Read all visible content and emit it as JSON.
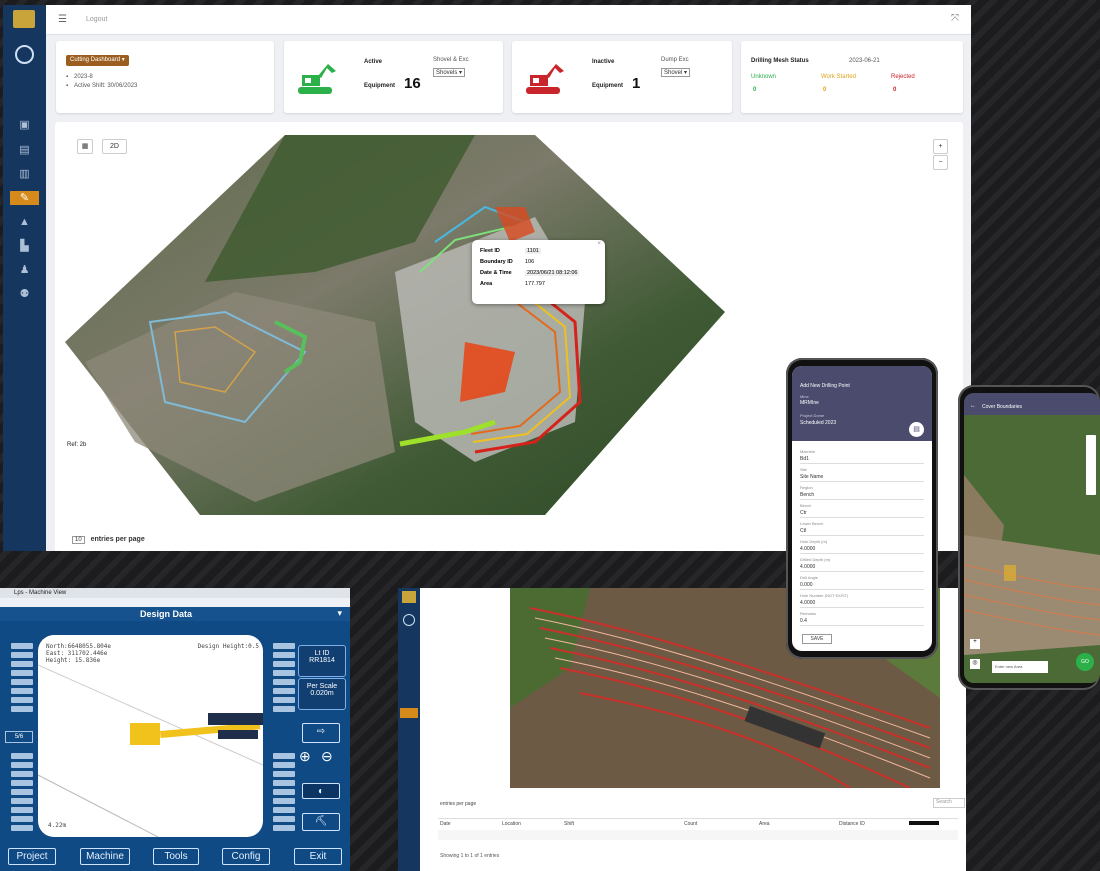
{
  "dashboard": {
    "topbar": {
      "title": "Logout",
      "menu_icon": "menu-icon",
      "close_icon": "close-icon"
    },
    "sidebar": {
      "icons": [
        "home-icon",
        "document-icon",
        "table-icon",
        "map-icon",
        "tool-icon",
        "building-icon",
        "factory-icon",
        "users-icon",
        "team-icon"
      ]
    },
    "project_card": {
      "button": "Cutting Dashboard ▾",
      "line1": "2023-8",
      "line2": "Active Shift: 30/06/2023"
    },
    "active_card": {
      "label": "Active",
      "sublabel": "Equipment",
      "count": "16",
      "filter_label": "Shovel & Exc",
      "select": "Shovels ▾",
      "color": "#2bb04a"
    },
    "inactive_card": {
      "label": "Inactive",
      "sublabel": "Equipment",
      "count": "1",
      "filter_label": "Dump Exc",
      "select": "Shovel ▾",
      "color": "#c8262c"
    },
    "drill_card": {
      "title": "Drilling Mesh Status",
      "date": "2023-06-21",
      "cols": [
        {
          "label": "Unknown",
          "value": "0",
          "color": "#2bb04a"
        },
        {
          "label": "Work Started",
          "value": "0",
          "color": "#e0a21a"
        },
        {
          "label": "Rejected",
          "value": "0",
          "color": "#c8262c"
        }
      ]
    },
    "map": {
      "layer_btn": "▦",
      "view_btn": "2D",
      "zoom_in": "+",
      "zoom_out": "−",
      "popup": [
        {
          "k": "Fleet ID",
          "v": "1101"
        },
        {
          "k": "Boundary ID",
          "v": "106"
        },
        {
          "k": "Date & Time",
          "v": "2023/06/21 08:12:06"
        },
        {
          "k": "Area",
          "v": "177.797"
        }
      ],
      "left_label": "Ref: 2b"
    },
    "footer": {
      "per_page": "10",
      "label": "entries per page"
    }
  },
  "design": {
    "title": "Lps - Machine View",
    "header": "Design Data",
    "readout": [
      "North:6648055.804e",
      "East: 311702.446e",
      "Height: 15.836e"
    ],
    "design_height": "Design Height:0.5",
    "scale_label": "4.22m",
    "info": [
      {
        "k": "Lt ID",
        "v": "RR1814"
      },
      {
        "k": "Per Scale",
        "v": "0.020m"
      }
    ],
    "bottom": [
      "Project",
      "Machine",
      "Tools",
      "Config",
      "Exit"
    ],
    "rail_label": "5/6"
  },
  "dash2": {
    "footer": {
      "label": "entries per page"
    },
    "search": "Search",
    "columns": [
      "Date",
      "Location",
      "Shift",
      "Count",
      "Area",
      "Distance ID",
      ""
    ],
    "status": "Showing 1 to 1 of 1 entries"
  },
  "phone1": {
    "header": "Add New Drilling Point",
    "subheader_label": "Mine",
    "subheader_value": "MRMIne",
    "project_label": "Project Dome",
    "project_value": "Scheduled 2023",
    "fields": [
      {
        "label": "Machine",
        "value": "Bd1"
      },
      {
        "label": "Site",
        "value": "Site Name"
      },
      {
        "label": "Region",
        "value": "Bench"
      },
      {
        "label": "Bench",
        "value": "Ctr"
      },
      {
        "label": "Lower Bench",
        "value": "Ctl"
      },
      {
        "label": "Hole Depth (m)",
        "value": "4.0000"
      },
      {
        "label": "Drilled Depth (m)",
        "value": "4.0000"
      },
      {
        "label": "Drill Angle",
        "value": "0.000"
      },
      {
        "label": "Hole Number (NOT EXIST)",
        "value": "4.0000"
      },
      {
        "label": "Remarks",
        "value": "0.4"
      }
    ],
    "button": "SAVE"
  },
  "phone2": {
    "header": "Cover Boundaries",
    "input": "Enter new Area",
    "fab": "GO"
  }
}
